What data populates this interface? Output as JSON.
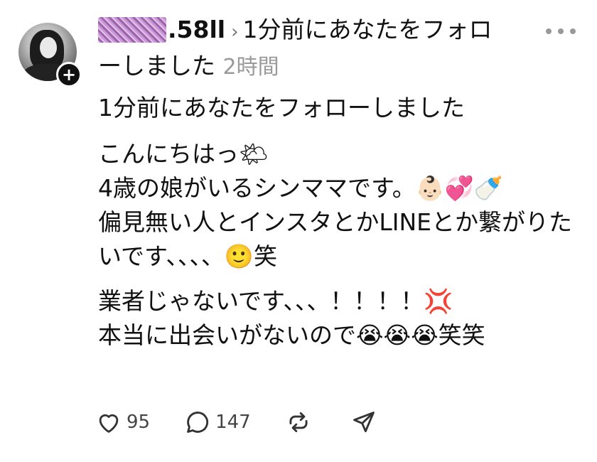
{
  "post": {
    "author_suffix": ".58ll",
    "chevron": "›",
    "header_line": "1分前にあなたをフォローしました",
    "timestamp": "2時間",
    "follow_icon": "plus-icon",
    "body_p1": "1分前にあなたをフォローしました",
    "body_p2": "こんにちはっ🌤\n4歳の娘がいるシンママです。👶🏻💞🍼\n偏見無い人とインスタとかLINEとか繋がりたいです、、、、🙂笑",
    "body_p3": "業者じゃないです、、、！！！！💢\n本当に出会いがないので😭😭😭笑笑"
  },
  "actions": {
    "like_count": "95",
    "reply_count": "147"
  }
}
